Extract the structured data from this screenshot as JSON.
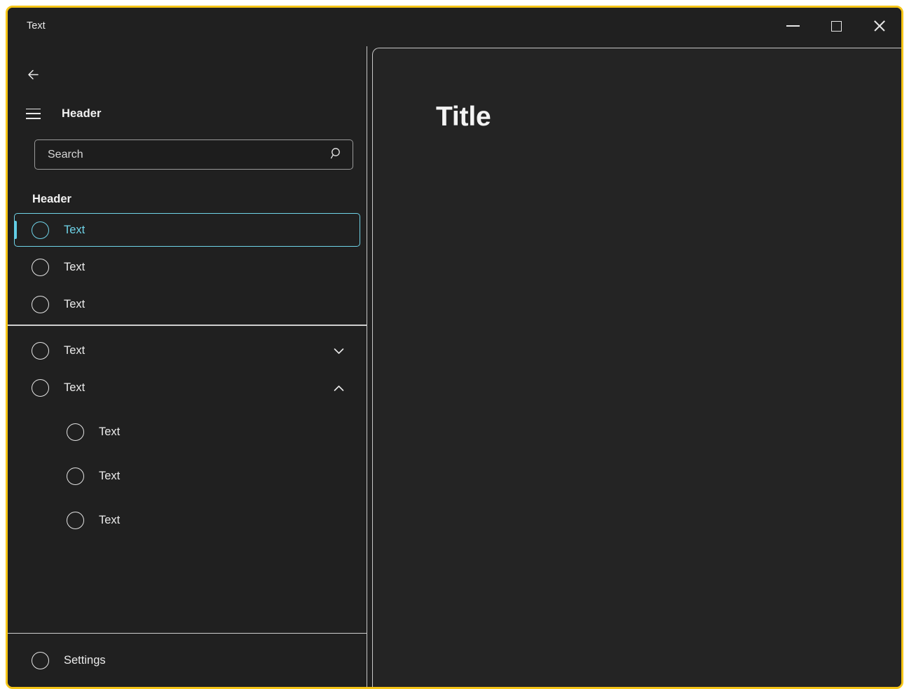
{
  "window": {
    "title": "Text",
    "accent_border_color": "#f5c518",
    "background_color": "#202020",
    "selection_color": "#6fd3e8"
  },
  "titlebar": {
    "title": "Text",
    "buttons": [
      {
        "name": "minimize",
        "label": "Minimize",
        "icon": "minimize-icon"
      },
      {
        "name": "maximize",
        "label": "Maximize",
        "icon": "maximize-icon"
      },
      {
        "name": "close",
        "label": "Close",
        "icon": "close-icon"
      }
    ]
  },
  "nav_pane": {
    "back_button": {
      "icon": "back-arrow-icon",
      "label": "Back"
    },
    "hamburger_button": {
      "icon": "hamburger-icon",
      "label": "Navigation menu"
    },
    "pane_title": "Header",
    "search": {
      "placeholder": "Search",
      "value": "",
      "icon": "search-icon"
    },
    "group_header": "Header",
    "items": [
      {
        "label": "Text",
        "icon": "circle-icon",
        "selected": true,
        "expandable": false
      },
      {
        "label": "Text",
        "icon": "circle-icon",
        "selected": false,
        "expandable": false
      },
      {
        "label": "Text",
        "icon": "circle-icon",
        "selected": false,
        "expandable": false
      }
    ],
    "expander_items": [
      {
        "label": "Text",
        "icon": "circle-icon",
        "expandable": true,
        "expanded": false,
        "chevron": "chevron-down-icon"
      },
      {
        "label": "Text",
        "icon": "circle-icon",
        "expandable": true,
        "expanded": true,
        "chevron": "chevron-up-icon"
      }
    ],
    "child_items": [
      {
        "label": "Text",
        "icon": "circle-icon"
      },
      {
        "label": "Text",
        "icon": "circle-icon"
      },
      {
        "label": "Text",
        "icon": "circle-icon"
      }
    ],
    "footer_item": {
      "label": "Settings",
      "icon": "circle-icon"
    }
  },
  "content": {
    "title": "Title"
  }
}
